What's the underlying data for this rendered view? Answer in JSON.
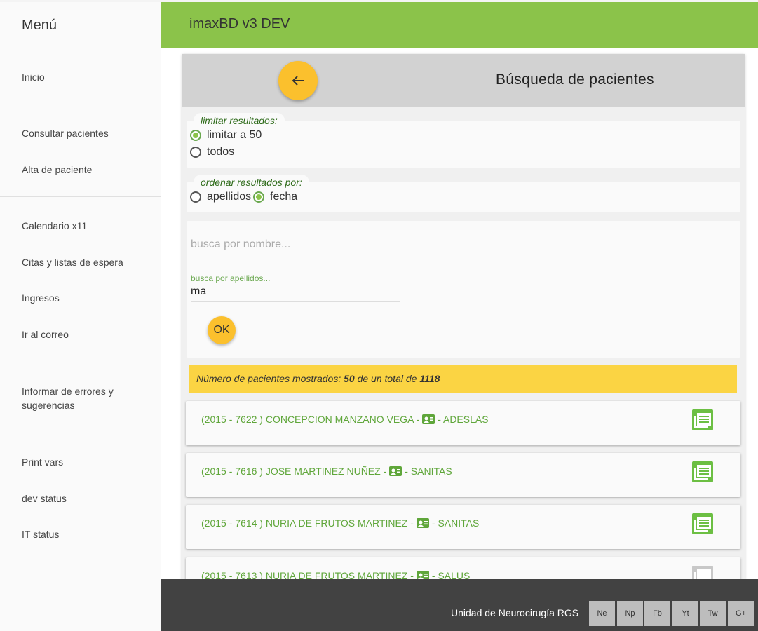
{
  "sidebar": {
    "title": "Menú",
    "items": [
      {
        "label": "Inicio"
      },
      {
        "label": "Consultar pacientes"
      },
      {
        "label": "Alta de paciente"
      },
      {
        "label": "Calendario x11"
      },
      {
        "label": "Citas y listas de espera"
      },
      {
        "label": "Ingresos"
      },
      {
        "label": "Ir al correo"
      },
      {
        "label": "Informar de errores y"
      },
      {
        "label": "sugerencias"
      },
      {
        "label": "Print vars"
      },
      {
        "label": "dev status"
      },
      {
        "label": "IT status"
      }
    ]
  },
  "header": {
    "title": "imaxBD v3 DEV"
  },
  "search": {
    "title": "Búsqueda de pacientes",
    "back_icon": "arrow-left-icon",
    "limit_legend": "limitar resultados:",
    "limit_options": [
      "limitar a 50",
      "todos"
    ],
    "limit_selected": "limitar a 50",
    "order_legend": "ordenar resultados por:",
    "order_options": [
      "apellidos",
      "fecha"
    ],
    "order_selected": "fecha",
    "name_placeholder": "busca por nombre...",
    "surname_label": "busca por apellidos...",
    "surname_value": "ma",
    "ok_label": "OK"
  },
  "results": {
    "count_prefix": "Número de pacientes mostrados: ",
    "shown": "50",
    "count_middle": " de un total de ",
    "total": "1118",
    "patients": [
      {
        "prefix": "(2015 - 7622 ) CONCEPCION MANZANO VEGA - ",
        "suffix": " - ADESLAS"
      },
      {
        "prefix": "(2015 - 7616 ) JOSE MARTINEZ NUÑEZ - ",
        "suffix": " - SANITAS"
      },
      {
        "prefix": "(2015 - 7614 ) NURIA DE FRUTOS MARTINEZ - ",
        "suffix": " - SANITAS"
      },
      {
        "prefix": "(2015 - 7613 ) NURIA DE FRUTOS MARTINEZ - ",
        "suffix": " - SALUS"
      }
    ]
  },
  "footer": {
    "org": "Unidad de Neurocirugía RGS",
    "social": [
      "Ne",
      "Np",
      "Fb",
      "Yt",
      "Tw",
      "G+"
    ]
  },
  "colors": {
    "header": "#8bc34a",
    "accent_button": "#fbc02d",
    "count_bar": "#fbd443",
    "patient_text": "#5fa63a",
    "footer": "#424242"
  }
}
